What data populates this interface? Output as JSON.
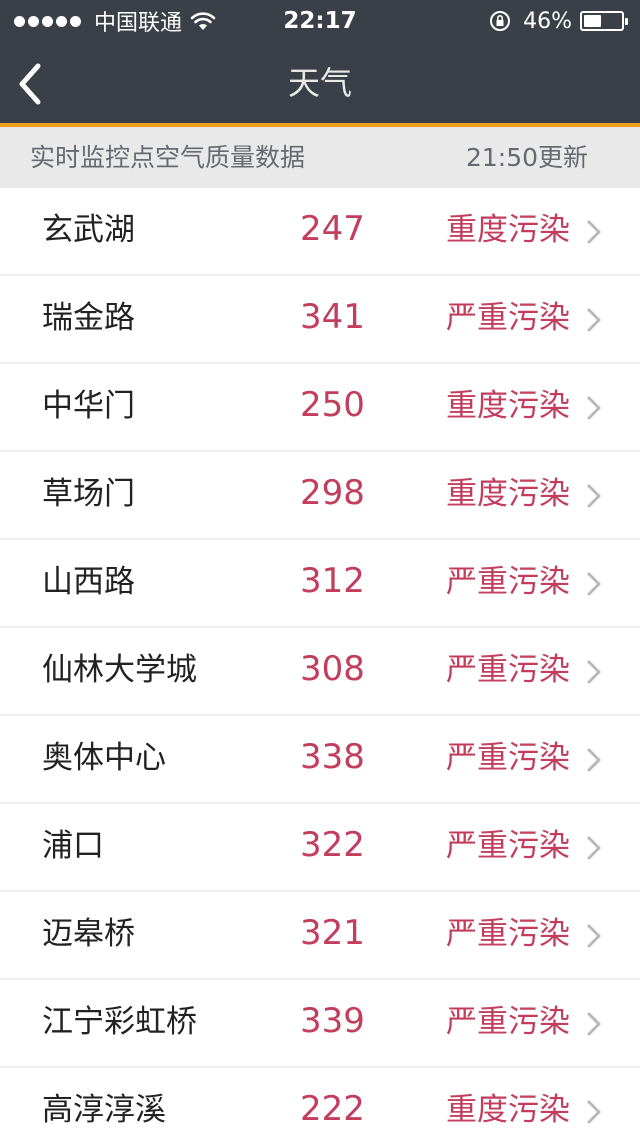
{
  "status_bar": {
    "carrier": "中国联通",
    "time": "22:17",
    "battery_text": "46%",
    "battery_level": 0.46
  },
  "navbar": {
    "title": "天气"
  },
  "subheader": {
    "title": "实时监控点空气质量数据",
    "updated": "21:50更新"
  },
  "colors": {
    "nav_bg": "#3a3f48",
    "accent": "#f0a21a",
    "pollution_text": "#c33d5e"
  },
  "stations": [
    {
      "name": "玄武湖",
      "aqi": "247",
      "level": "重度污染"
    },
    {
      "name": "瑞金路",
      "aqi": "341",
      "level": "严重污染"
    },
    {
      "name": "中华门",
      "aqi": "250",
      "level": "重度污染"
    },
    {
      "name": "草场门",
      "aqi": "298",
      "level": "重度污染"
    },
    {
      "name": "山西路",
      "aqi": "312",
      "level": "严重污染"
    },
    {
      "name": "仙林大学城",
      "aqi": "308",
      "level": "严重污染"
    },
    {
      "name": "奥体中心",
      "aqi": "338",
      "level": "严重污染"
    },
    {
      "name": "浦口",
      "aqi": "322",
      "level": "严重污染"
    },
    {
      "name": "迈皋桥",
      "aqi": "321",
      "level": "严重污染"
    },
    {
      "name": "江宁彩虹桥",
      "aqi": "339",
      "level": "严重污染"
    },
    {
      "name": "高淳淳溪",
      "aqi": "222",
      "level": "重度污染"
    }
  ]
}
